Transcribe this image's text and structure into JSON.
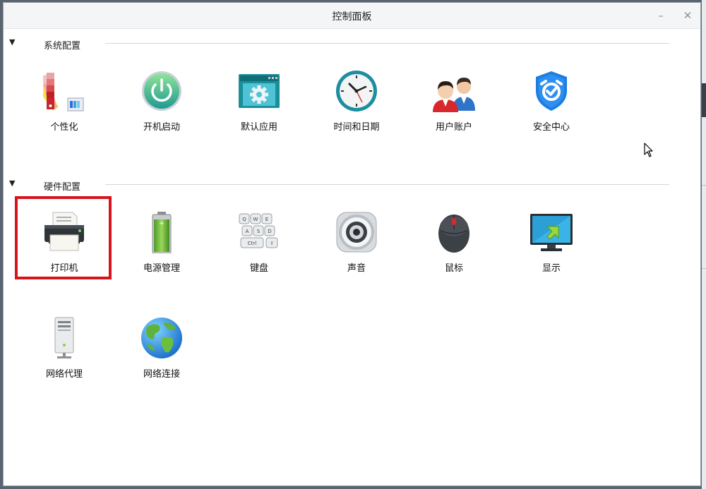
{
  "window": {
    "title": "控制面板",
    "minimize_glyph": "–",
    "close_glyph": "✕"
  },
  "sections": [
    {
      "label": "系统配置",
      "items": [
        {
          "label": "个性化",
          "icon": "color-palette-icon"
        },
        {
          "label": "开机启动",
          "icon": "power-icon"
        },
        {
          "label": "默认应用",
          "icon": "default-apps-gear-icon"
        },
        {
          "label": "时间和日期",
          "icon": "clock-icon"
        },
        {
          "label": "用户账户",
          "icon": "users-icon"
        },
        {
          "label": "安全中心",
          "icon": "shield-icon"
        }
      ]
    },
    {
      "label": "硬件配置",
      "items": [
        {
          "label": "打印机",
          "icon": "printer-icon"
        },
        {
          "label": "电源管理",
          "icon": "battery-icon"
        },
        {
          "label": "键盘",
          "icon": "keyboard-icon"
        },
        {
          "label": "声音",
          "icon": "speaker-icon"
        },
        {
          "label": "鼠标",
          "icon": "mouse-icon"
        },
        {
          "label": "显示",
          "icon": "monitor-icon"
        },
        {
          "label": "网络代理",
          "icon": "proxy-server-icon"
        },
        {
          "label": "网络连接",
          "icon": "globe-icon"
        }
      ]
    }
  ],
  "keyboard_keys": [
    "Q",
    "W",
    "E",
    "A",
    "S",
    "D",
    "Ctrl",
    "⇧"
  ],
  "colors": {
    "highlight": "#d7141c",
    "window_bg": "#ffffff",
    "titlebar_bg": "#f4f5f6"
  }
}
